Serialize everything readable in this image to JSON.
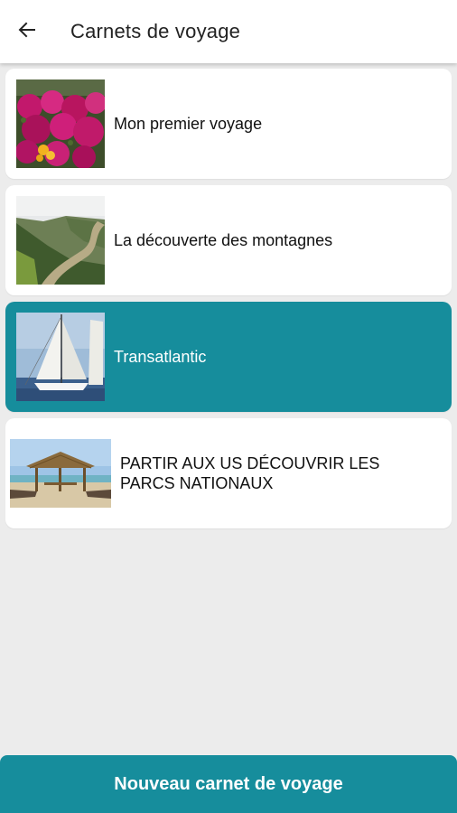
{
  "header": {
    "back_icon": "arrow-left-icon",
    "title": "Carnets de voyage"
  },
  "carnets": [
    {
      "label": "Mon premier voyage",
      "image": "flowers-photo",
      "selected": false
    },
    {
      "label": "La découverte des montagnes",
      "image": "river-valley-photo",
      "selected": false
    },
    {
      "label": "Transatlantic",
      "image": "sailboat-photo",
      "selected": true
    },
    {
      "label": "PARTIR AUX US DÉCOUVRIR LES PARCS NATIONAUX",
      "image": "beach-hut-photo",
      "selected": false
    }
  ],
  "footer": {
    "new_button_label": "Nouveau carnet de voyage"
  },
  "colors": {
    "accent": "#168d9c",
    "background": "#ececec",
    "card": "#ffffff"
  }
}
